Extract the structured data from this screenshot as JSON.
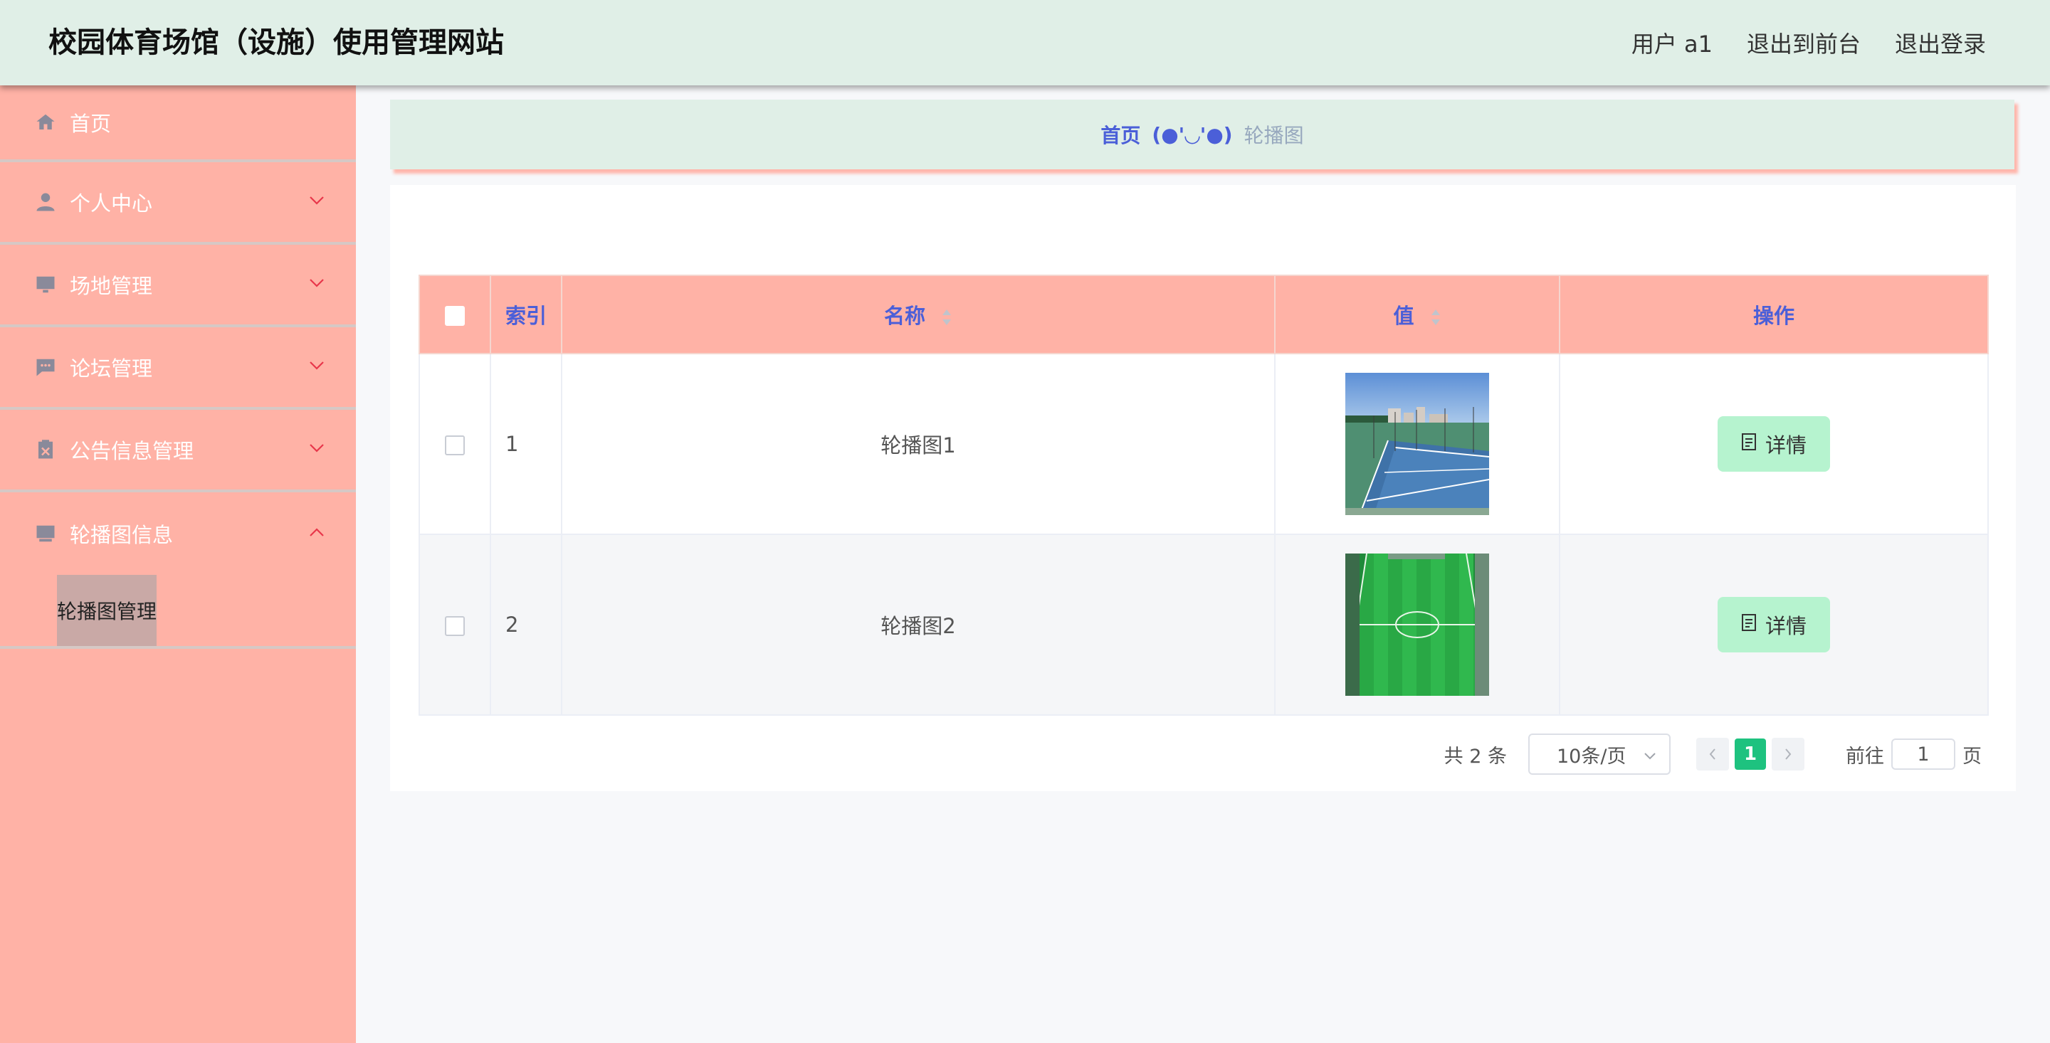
{
  "header": {
    "title": "校园体育场馆（设施）使用管理网站",
    "user_label": "用户 a1",
    "back_to_front": "退出到前台",
    "logout": "退出登录"
  },
  "sidebar": {
    "items": [
      {
        "label": "首页",
        "icon": "home-icon"
      },
      {
        "label": "个人中心",
        "icon": "user-icon"
      },
      {
        "label": "场地管理",
        "icon": "monitor-icon"
      },
      {
        "label": "论坛管理",
        "icon": "chat-icon"
      },
      {
        "label": "公告信息管理",
        "icon": "clipboard-icon"
      },
      {
        "label": "轮播图信息",
        "icon": "picture-icon"
      }
    ],
    "sub_item": "轮播图管理"
  },
  "breadcrumb": {
    "home": "首页",
    "separator": "(●'◡'●)",
    "current": "轮播图"
  },
  "table": {
    "headers": {
      "index": "索引",
      "name": "名称",
      "value": "值",
      "action": "操作"
    },
    "rows": [
      {
        "index": "1",
        "name": "轮播图1",
        "image": "tennis-court-photo"
      },
      {
        "index": "2",
        "name": "轮播图2",
        "image": "soccer-field-photo"
      }
    ],
    "detail_label": "详情"
  },
  "pagination": {
    "total": "共 2 条",
    "page_size": "10条/页",
    "current_page": "1",
    "goto_prefix": "前往",
    "goto_value": "1",
    "goto_suffix": "页"
  },
  "colors": {
    "header_bg": "#e0efe7",
    "sidebar_bg": "#ffb2a6",
    "accent_text": "#4b5fd8",
    "detail_button": "#b6f3cf",
    "active_page": "#1ec27f"
  }
}
